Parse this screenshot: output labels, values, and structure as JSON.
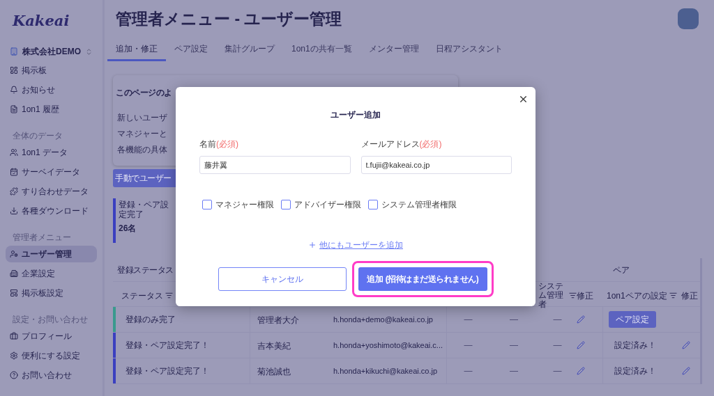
{
  "sidebar": {
    "logo": "Kakeai",
    "org": "株式会社DEMO",
    "groups": [
      {
        "items": [
          {
            "label": "掲示板",
            "selected": false
          },
          {
            "label": "お知らせ",
            "selected": false
          },
          {
            "label": "1on1 履歴",
            "selected": false
          }
        ]
      },
      {
        "heading": "全体のデータ",
        "items": [
          {
            "label": "1on1 データ",
            "selected": false
          },
          {
            "label": "サーベイデータ",
            "selected": false
          },
          {
            "label": "すり合わせデータ",
            "selected": false
          },
          {
            "label": "各種ダウンロード",
            "selected": false
          }
        ]
      },
      {
        "heading": "管理者メニュー",
        "items": [
          {
            "label": "ユーザー管理",
            "selected": true
          },
          {
            "label": "企業設定",
            "selected": false
          },
          {
            "label": "掲示板設定",
            "selected": false
          }
        ]
      },
      {
        "heading": "設定・お問い合わせ",
        "items": [
          {
            "label": "プロフィール",
            "selected": false
          },
          {
            "label": "便利にする設定",
            "selected": false
          },
          {
            "label": "お問い合わせ",
            "selected": false
          }
        ]
      }
    ]
  },
  "header": {
    "title": "管理者メニュー - ユーザー管理"
  },
  "tabs": [
    {
      "label": "追加・修正",
      "selected": true
    },
    {
      "label": "ペア設定",
      "selected": false
    },
    {
      "label": "集計グループ",
      "selected": false
    },
    {
      "label": "1on1の共有一覧",
      "selected": false
    },
    {
      "label": "メンター管理",
      "selected": false
    },
    {
      "label": "日程アシスタント",
      "selected": false
    }
  ],
  "info_card": {
    "title": "このページのよ",
    "lines": [
      "新しいユーザ",
      "マネジャーと",
      "各機能の具体"
    ]
  },
  "manual_add_button": "手動でユーザー",
  "stat": {
    "label": "登録・ペア設定完了",
    "value": "26名"
  },
  "table": {
    "groups": [
      "登録ステータス",
      "ペア"
    ],
    "columns": [
      {
        "label": "ステータス",
        "filter": true
      },
      {
        "label": "システム管理者",
        "filter": true
      },
      {
        "label": "修正",
        "filter": false
      },
      {
        "label": "1on1ペアの設定",
        "filter": true
      },
      {
        "label": "修正",
        "filter": false
      }
    ],
    "rows": [
      {
        "status": "登録のみ完了",
        "color": "#3a9a8e",
        "name": "管理者大介",
        "email": "h.honda+demo@kakeai.co.jp",
        "flags": [
          "—",
          "—",
          "—"
        ],
        "pair": {
          "kind": "button",
          "label": "ペア設定"
        }
      },
      {
        "status": "登録・ペア設定完了！",
        "color": "#3b3fc0",
        "name": "吉本美紀",
        "email": "h.honda+yoshimoto@kakeai.c...",
        "flags": [
          "—",
          "—",
          "—"
        ],
        "pair": {
          "kind": "done",
          "label": "設定済み！"
        }
      },
      {
        "status": "登録・ペア設定完了！",
        "color": "#3b3fc0",
        "name": "菊池誠也",
        "email": "h.honda+kikuchi@kakeai.co.jp",
        "flags": [
          "—",
          "—",
          "—"
        ],
        "pair": {
          "kind": "done",
          "label": "設定済み！"
        }
      }
    ]
  },
  "modal": {
    "title": "ユーザー追加",
    "fields": [
      {
        "label": "名前",
        "required": "(必須)",
        "value": "藤井翼"
      },
      {
        "label": "メールアドレス",
        "required": "(必須)",
        "value": "t.fujii@kakeai.co.jp"
      }
    ],
    "permissions": [
      {
        "label": "マネジャー権限",
        "checked": false
      },
      {
        "label": "アドバイザー権限",
        "checked": false
      },
      {
        "label": "システム管理者権限",
        "checked": false
      }
    ],
    "add_more_link": "他にもユーザーを追加",
    "cancel": "キャンセル",
    "submit": {
      "label": "追加",
      "note": "(招待はまだ送られません)",
      "highlighted": true
    }
  }
}
